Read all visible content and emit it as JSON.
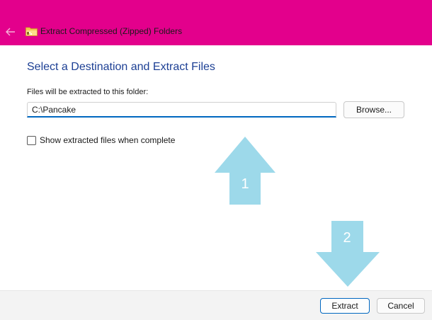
{
  "window": {
    "title": "Extract Compressed (Zipped) Folders",
    "accent_color": "#e3008c"
  },
  "icons": {
    "back": "back-arrow-icon",
    "folder": "zipped-folder-icon"
  },
  "main": {
    "heading": "Select a Destination and Extract Files",
    "destination_label": "Files will be extracted to this folder:",
    "destination_value": "C:\\Pancake",
    "browse_label": "Browse...",
    "show_files_label": "Show extracted files when complete",
    "show_files_checked": false
  },
  "annotations": {
    "arrow_color": "#9dd9ea",
    "step1": "1",
    "step2": "2"
  },
  "footer": {
    "extract_label": "Extract",
    "cancel_label": "Cancel"
  }
}
